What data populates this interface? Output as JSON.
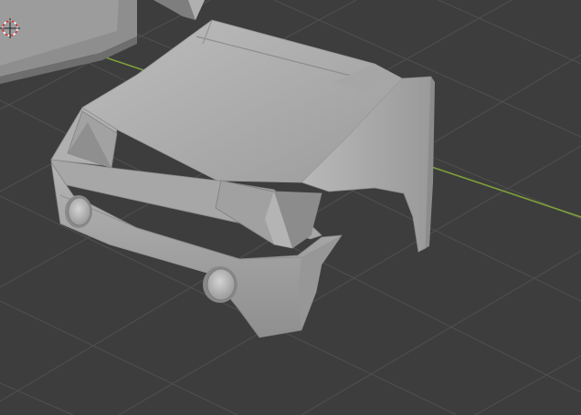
{
  "viewport": {
    "background_color": "#3d3d3d",
    "grid_color": "#505050",
    "x_axis_color": "#7fa23a",
    "icons": {
      "cursor": "3d-cursor-icon"
    },
    "objects": [
      {
        "name": "car-front-body-mesh",
        "kind": "mesh",
        "shading": "solid",
        "color": "#a9a9a9"
      },
      {
        "name": "background-mesh-part",
        "kind": "mesh",
        "shading": "solid",
        "color": "#9a9a9a"
      }
    ]
  }
}
